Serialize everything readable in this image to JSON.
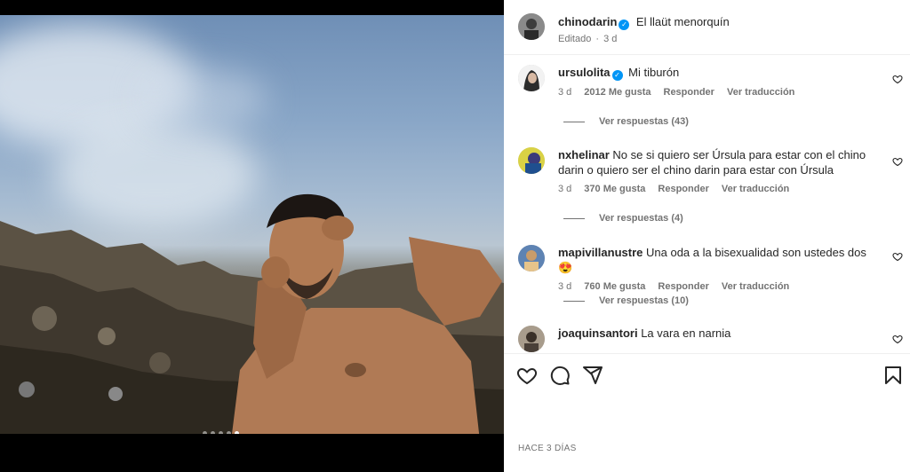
{
  "post": {
    "author": "chinodarin",
    "caption": "El llaüt menorquín",
    "edited": "Editado",
    "time": "3 d",
    "carousel": {
      "count": 5,
      "active_index": 5
    },
    "time_ago": "HACE 3 DÍAS"
  },
  "comments": [
    {
      "user": "ursulolita",
      "verified": true,
      "text": "Mi tiburón",
      "time": "3 d",
      "likes": "2012 Me gusta",
      "reply": "Responder",
      "translate": "Ver traducción",
      "replies": "Ver respuestas (43)"
    },
    {
      "user": "nxhelinar",
      "verified": false,
      "text": "No se si quiero ser Úrsula para estar con el chino darin o quiero ser el chino darin para estar con Úrsula",
      "time": "3 d",
      "likes": "370 Me gusta",
      "reply": "Responder",
      "translate": "Ver traducción",
      "replies": "Ver respuestas (4)"
    },
    {
      "user": "mapivillanustre",
      "verified": false,
      "text": "Una oda a la bisexualidad son ustedes dos 😍",
      "time": "3 d",
      "likes": "760 Me gusta",
      "reply": "Responder",
      "translate": "Ver traducción",
      "replies": "Ver respuestas (10)"
    },
    {
      "user": "joaquinsantori",
      "verified": false,
      "text": "La vara en narnia"
    }
  ],
  "icons": {
    "like": "heart-icon",
    "comment": "comment-icon",
    "share": "send-icon",
    "save": "bookmark-icon",
    "verified": "verified-badge-icon"
  },
  "colors": {
    "verified": "#0095f6",
    "meta": "#737373"
  }
}
